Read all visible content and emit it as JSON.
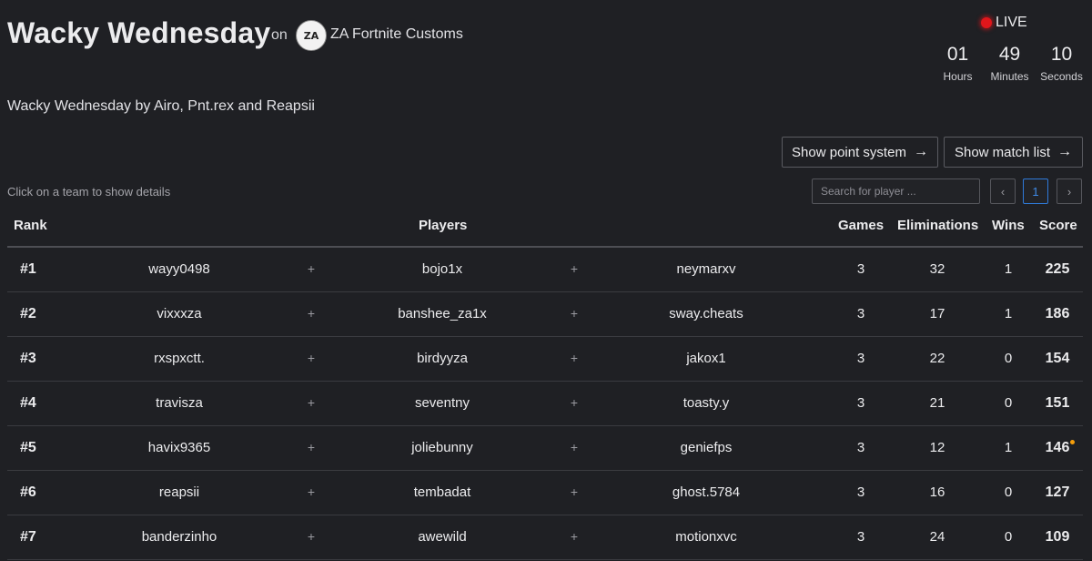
{
  "header": {
    "title": "Wacky Wednesday",
    "on_label": "on",
    "org_logo_text": "ZA",
    "org_name": "ZA Fortnite Customs",
    "subtitle": "Wacky Wednesday by Airo, Pnt.rex and Reapsii"
  },
  "live": {
    "label": "LIVE",
    "indicator_color": "#e0161b",
    "countdown": [
      {
        "value": "01",
        "label": "Hours"
      },
      {
        "value": "49",
        "label": "Minutes"
      },
      {
        "value": "10",
        "label": "Seconds"
      }
    ]
  },
  "actions": {
    "point_system_label": "Show point system",
    "match_list_label": "Show match list",
    "arrow_icon": "→"
  },
  "controls": {
    "hint": "Click on a team to show details",
    "search_placeholder": "Search for player ...",
    "search_value": "",
    "pagination": {
      "prev_icon": "‹",
      "current_page": "1",
      "next_icon": "›"
    }
  },
  "table": {
    "columns": {
      "rank": "Rank",
      "players": "Players",
      "games": "Games",
      "eliminations": "Eliminations",
      "wins": "Wins",
      "score": "Score"
    },
    "separator": "+",
    "rows": [
      {
        "rank": "#1",
        "p1": "wayy0498",
        "p2": "bojo1x",
        "p3": "neymarxv",
        "games": "3",
        "elims": "32",
        "wins": "1",
        "score": "225"
      },
      {
        "rank": "#2",
        "p1": "vixxxza",
        "p2": "banshee_za1x",
        "p3": "sway.cheats",
        "games": "3",
        "elims": "17",
        "wins": "1",
        "score": "186"
      },
      {
        "rank": "#3",
        "p1": "rxspxctt.",
        "p2": "birdyyza",
        "p3": "jakox1",
        "games": "3",
        "elims": "22",
        "wins": "0",
        "score": "154"
      },
      {
        "rank": "#4",
        "p1": "travisza",
        "p2": "seventny",
        "p3": "toasty.y",
        "games": "3",
        "elims": "21",
        "wins": "0",
        "score": "151"
      },
      {
        "rank": "#5",
        "p1": "havix9365",
        "p2": "joliebunny",
        "p3": "geniefps",
        "games": "3",
        "elims": "12",
        "wins": "1",
        "score": "146"
      },
      {
        "rank": "#6",
        "p1": "reapsii",
        "p2": "tembadat",
        "p3": "ghost.5784",
        "games": "3",
        "elims": "16",
        "wins": "0",
        "score": "127"
      },
      {
        "rank": "#7",
        "p1": "banderzinho",
        "p2": "awewild",
        "p3": "motionxvc",
        "games": "3",
        "elims": "24",
        "wins": "0",
        "score": "109"
      }
    ]
  }
}
